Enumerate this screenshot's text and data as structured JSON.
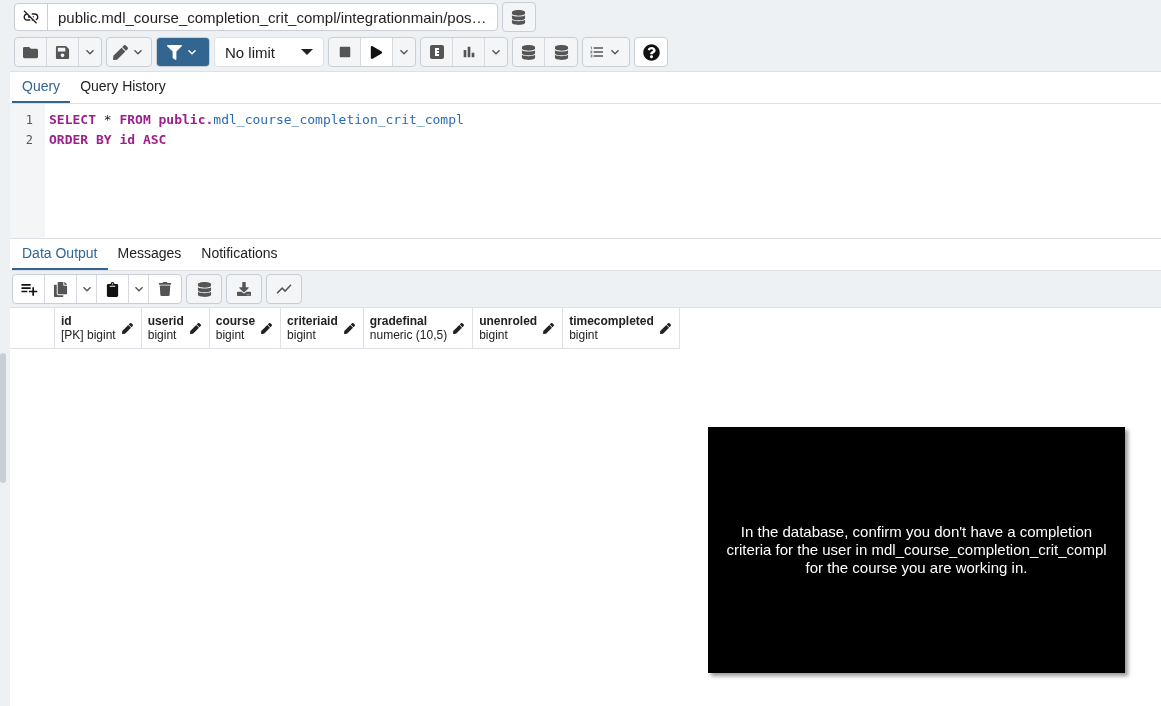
{
  "connection": {
    "title": "public.mdl_course_completion_crit_compl/integrationmain/pos…"
  },
  "toolbar": {
    "filter_active": true,
    "limit": "No limit"
  },
  "query_tabs": [
    {
      "label": "Query",
      "selected": true
    },
    {
      "label": "Query History",
      "selected": false
    }
  ],
  "editor": {
    "lines": [
      {
        "number": "1",
        "tokens": [
          {
            "kind": "keyword",
            "text": "SELECT"
          },
          {
            "kind": "plain",
            "text": "*"
          },
          {
            "kind": "keyword",
            "text": "FROM"
          },
          {
            "kind": "keyword",
            "text": "public."
          },
          {
            "kind": "identifier",
            "text": "mdl_course_completion_crit_compl"
          }
        ]
      },
      {
        "number": "2",
        "tokens": [
          {
            "kind": "keyword",
            "text": "ORDER BY"
          },
          {
            "kind": "keyword",
            "text": "id"
          },
          {
            "kind": "keyword",
            "text": "ASC"
          }
        ]
      }
    ]
  },
  "output_tabs": [
    {
      "label": "Data Output",
      "selected": true
    },
    {
      "label": "Messages",
      "selected": false
    },
    {
      "label": "Notifications",
      "selected": false
    }
  ],
  "table": {
    "columns": [
      {
        "name": "id",
        "type": "[PK] bigint"
      },
      {
        "name": "userid",
        "type": "bigint"
      },
      {
        "name": "course",
        "type": "bigint"
      },
      {
        "name": "criteriaid",
        "type": "bigint"
      },
      {
        "name": "gradefinal",
        "type": "numeric (10,5)"
      },
      {
        "name": "unenroled",
        "type": "bigint"
      },
      {
        "name": "timecompleted",
        "type": "bigint"
      }
    ]
  },
  "note": {
    "text": "In the database, confirm you don't have a completion criteria for the user in mdl_course_completion_crit_compl for the course you are working in."
  }
}
